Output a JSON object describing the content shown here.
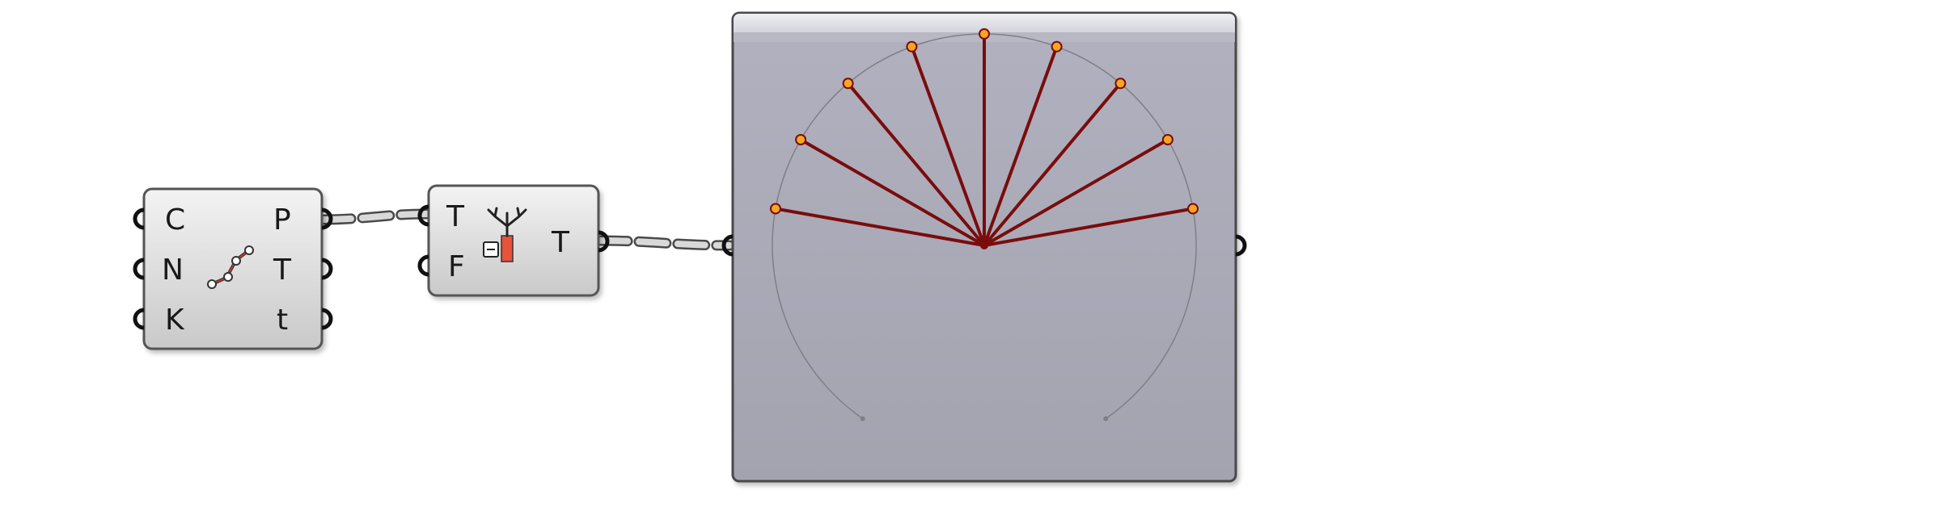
{
  "components": {
    "divide_curve": {
      "inputs": [
        "C",
        "N",
        "K"
      ],
      "outputs": [
        "P",
        "T",
        "t"
      ],
      "icon": "divide-curve-icon"
    },
    "flatten_tree": {
      "inputs": [
        "T",
        "F"
      ],
      "outputs": [
        "T"
      ],
      "icon": "flatten-tree-icon"
    },
    "tree_viewer": {
      "icon": "tree-viewer-icon",
      "branch_count": 9,
      "colors": {
        "branch": "#7a0c0c",
        "node_fill": "#f5a623",
        "node_stroke": "#7a0c0c",
        "arc": "#7f7f88",
        "panel": "#a9a9b6"
      }
    }
  },
  "colors": {
    "wire": "#8a8a8a",
    "component_fill": "#dcdcdc",
    "component_stroke": "#555555"
  }
}
